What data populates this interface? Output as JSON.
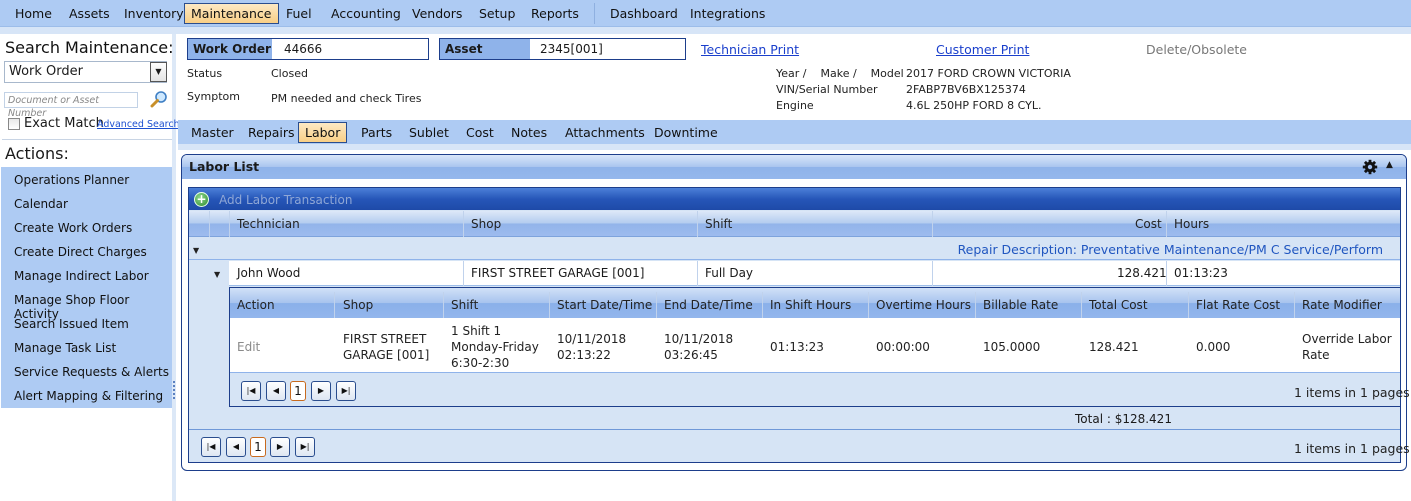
{
  "menu": {
    "items": [
      {
        "label": "Home",
        "active": false
      },
      {
        "label": "Assets",
        "active": false
      },
      {
        "label": "Inventory",
        "active": false
      },
      {
        "label": "Maintenance",
        "active": true
      },
      {
        "label": "Fuel",
        "active": false
      },
      {
        "label": "Accounting",
        "active": false
      },
      {
        "label": "Vendors",
        "active": false
      },
      {
        "label": "Setup",
        "active": false
      },
      {
        "label": "Reports",
        "active": false
      },
      {
        "label": "Dashboard",
        "active": false
      },
      {
        "label": "Integrations",
        "active": false
      }
    ]
  },
  "sidebar": {
    "title": "Search Maintenance:",
    "search_type": "Work Order",
    "search_placeholder": "Document or Asset Number",
    "exact_match_label": "Exact Match",
    "exact_match_checked": false,
    "advanced_search": "Advanced Search",
    "actions_title": "Actions:",
    "actions": [
      "Operations Planner",
      "Calendar",
      "Create Work Orders",
      "Create Direct Charges",
      "Manage Indirect Labor",
      "Manage Shop Floor Activity",
      "Search Issued Item",
      "Manage Task List",
      "Service Requests & Alerts",
      "Alert Mapping & Filtering"
    ]
  },
  "header": {
    "work_order_label": "Work Order",
    "work_order_value": "44666",
    "asset_label": "Asset",
    "asset_value": "2345[001]",
    "technician_print": "Technician Print",
    "customer_print": "Customer Print",
    "delete_obsolete": "Delete/Obsolete",
    "status_label": "Status",
    "status_value": "Closed",
    "symptom_label": "Symptom",
    "symptom_value": "PM needed and check Tires",
    "ymm_label": "Year /    Make /    Model",
    "ymm_value": "2017 FORD CROWN VICTORIA",
    "vin_label": "VIN/Serial Number",
    "vin_value": "2FABP7BV6BX125374",
    "engine_label": "Engine",
    "engine_value": "4.6L 250HP FORD 8 CYL."
  },
  "tabs": [
    {
      "label": "Master",
      "active": false
    },
    {
      "label": "Repairs",
      "active": false
    },
    {
      "label": "Labor",
      "active": true
    },
    {
      "label": "Parts",
      "active": false
    },
    {
      "label": "Sublet",
      "active": false
    },
    {
      "label": "Cost",
      "active": false
    },
    {
      "label": "Notes",
      "active": false
    },
    {
      "label": "Attachments",
      "active": false
    },
    {
      "label": "Downtime",
      "active": false
    }
  ],
  "labor": {
    "title": "Labor List",
    "add_label": "Add Labor Transaction",
    "columns": [
      "Technician",
      "Shop",
      "Shift",
      "Cost",
      "Hours"
    ],
    "group_label": "Repair Description: Preventative Maintenance/PM C Service/Perform",
    "row": {
      "technician": "John Wood",
      "shop": "FIRST STREET GARAGE [001]",
      "shift": "Full Day",
      "cost": "128.421",
      "hours": "01:13:23"
    },
    "detail": {
      "columns": [
        "Action",
        "Shop",
        "Shift",
        "Start Date/Time",
        "End Date/Time",
        "In Shift Hours",
        "Overtime Hours",
        "Billable Rate",
        "Total Cost",
        "Flat Rate Cost",
        "Rate Modifier"
      ],
      "row": {
        "action": "Edit",
        "shop_line1": "FIRST STREET",
        "shop_line2": "GARAGE [001]",
        "shift_line1": "1 Shift 1",
        "shift_line2": "Monday-Friday",
        "shift_line3": "6:30-2:30",
        "start_date": "10/11/2018",
        "start_time": "02:13:22",
        "end_date": "10/11/2018",
        "end_time": "03:26:45",
        "in_shift_hours": "01:13:23",
        "overtime_hours": "00:00:00",
        "billable_rate": "105.0000",
        "total_cost": "128.421",
        "flat_rate_cost": "0.000",
        "rate_modifier_line1": "Override Labor",
        "rate_modifier_line2": "Rate"
      },
      "pager": {
        "current_page": "1",
        "info": "1 items in 1 pages"
      }
    },
    "total": "Total : $128.421",
    "pager": {
      "current_page": "1",
      "info": "1 items in 1 pages"
    }
  }
}
